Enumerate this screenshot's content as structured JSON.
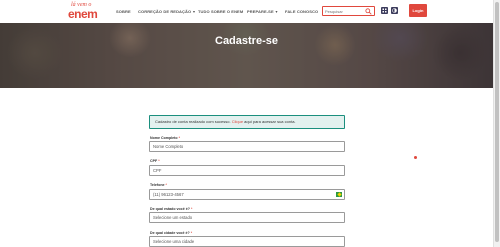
{
  "header": {
    "logo_top": "lá vem o",
    "logo_main": "enem",
    "nav": [
      {
        "label": "SOBRE",
        "dropdown": false
      },
      {
        "label": "CORREÇÃO DE REDAÇÃO",
        "dropdown": true
      },
      {
        "label": "TUDO SOBRE O ENEM",
        "dropdown": false
      },
      {
        "label": "PREPARE-SE",
        "dropdown": true
      },
      {
        "label": "FALE CONOSCO",
        "dropdown": false
      }
    ],
    "search_placeholder": "Pesquisar",
    "login_label": "Login"
  },
  "hero": {
    "title": "Cadastre-se"
  },
  "alert": {
    "text": "Cadastro de conta realizado com sucesso. ",
    "link_text": "Clique",
    "text_after": " aqui para acessar sua conta."
  },
  "form": {
    "fields": [
      {
        "label": "Nome Completo",
        "value": "Nome Completo"
      },
      {
        "label": "CPF",
        "value": "CPF"
      },
      {
        "label": "Telefone",
        "value": "(11) 96123-4567"
      },
      {
        "label": "De qual estado você é?",
        "value": "Selecione um estado"
      },
      {
        "label": "De qual cidade você é?",
        "value": "Selecione uma cidade"
      }
    ]
  },
  "colors": {
    "brand": "#e0483d",
    "alert_border": "#1b8f7e",
    "alert_bg": "#e3f1ef"
  }
}
